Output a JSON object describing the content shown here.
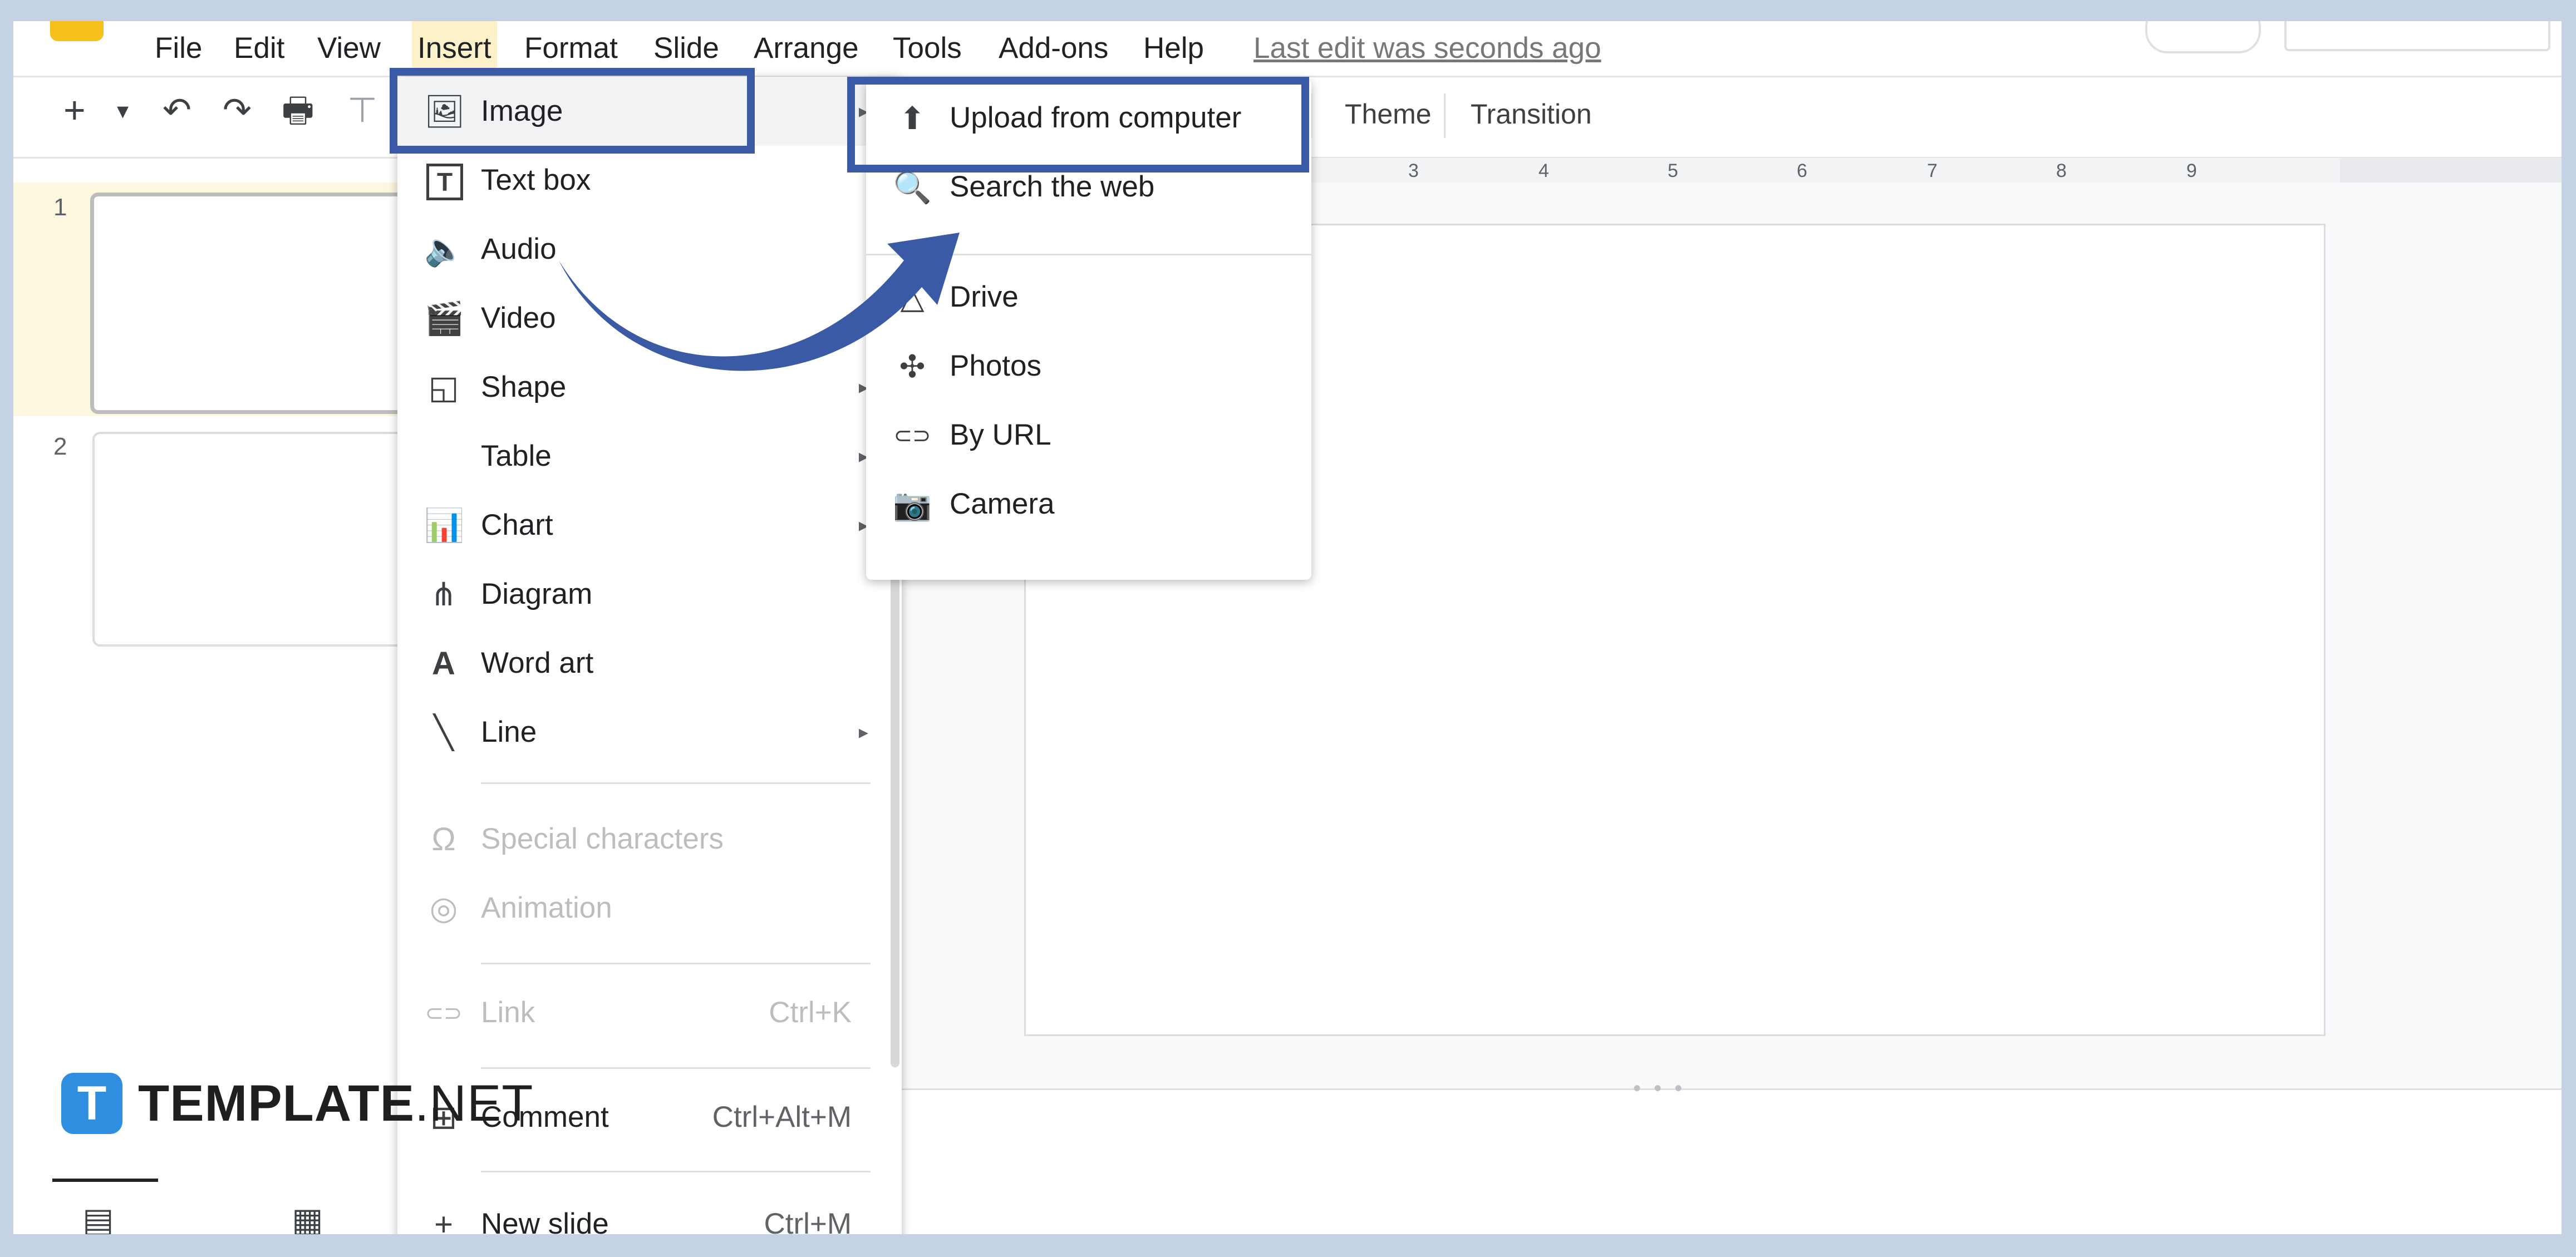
{
  "menubar": {
    "items": [
      "File",
      "Edit",
      "View",
      "Insert",
      "Format",
      "Slide",
      "Arrange",
      "Tools",
      "Add-ons",
      "Help"
    ],
    "last_edit": "Last edit was seconds ago"
  },
  "toolbar": {
    "add": "+",
    "dropdown": "▾",
    "undo": "↶",
    "redo": "↷",
    "print": "🖶",
    "theme": "Theme",
    "transition": "Transition"
  },
  "ruler": {
    "ticks": [
      "3",
      "4",
      "5",
      "6",
      "7",
      "8",
      "9"
    ]
  },
  "slides_panel": {
    "numbers": [
      "1",
      "2"
    ]
  },
  "insert_menu": {
    "items": [
      {
        "label": "Image",
        "icon": "image-icon",
        "glyph": "🖼",
        "arrow": "▸"
      },
      {
        "label": "Text box",
        "icon": "text-box-icon",
        "glyph": "T"
      },
      {
        "label": "Audio",
        "icon": "audio-icon",
        "glyph": "🔈"
      },
      {
        "label": "Video",
        "icon": "video-icon",
        "glyph": "🎬"
      },
      {
        "label": "Shape",
        "icon": "shape-icon",
        "glyph": "◱",
        "arrow": "▸"
      },
      {
        "label": "Table",
        "icon": "",
        "glyph": "",
        "arrow": "▸"
      },
      {
        "label": "Chart",
        "icon": "chart-icon",
        "glyph": "📊",
        "arrow": "▸"
      },
      {
        "label": "Diagram",
        "icon": "diagram-icon",
        "glyph": "⋔"
      },
      {
        "label": "Word art",
        "icon": "word-art-icon",
        "glyph": "A"
      },
      {
        "label": "Line",
        "icon": "line-icon",
        "glyph": "╲",
        "arrow": "▸"
      },
      {
        "label": "Special characters",
        "icon": "omega-icon",
        "glyph": "Ω"
      },
      {
        "label": "Animation",
        "icon": "animation-icon",
        "glyph": "◎"
      },
      {
        "label": "Link",
        "icon": "link-icon",
        "glyph": "⊂⊃",
        "shortcut": "Ctrl+K"
      },
      {
        "label": "Comment",
        "icon": "comment-icon",
        "glyph": "⊞",
        "shortcut": "Ctrl+Alt+M"
      },
      {
        "label": "New slide",
        "icon": "new-slide-icon",
        "glyph": "+",
        "shortcut": "Ctrl+M"
      }
    ]
  },
  "image_submenu": {
    "items": [
      {
        "label": "Upload from computer",
        "icon": "upload-icon",
        "glyph": "⬆"
      },
      {
        "label": "Search the web",
        "icon": "search-icon",
        "glyph": "🔍"
      },
      {
        "label": "Drive",
        "icon": "drive-icon",
        "glyph": "△"
      },
      {
        "label": "Photos",
        "icon": "photos-icon",
        "glyph": "✣"
      },
      {
        "label": "By URL",
        "icon": "link-icon",
        "glyph": "⊂⊃"
      },
      {
        "label": "Camera",
        "icon": "camera-icon",
        "glyph": "📷"
      }
    ]
  },
  "brand": {
    "logo_letter": "T",
    "name_bold": "TEMPLATE",
    "name_light": ".NET"
  },
  "colors": {
    "highlight": "#3a5aa6",
    "insert_bg": "#fdf1c9",
    "slide_selected": "#fef7e0"
  }
}
